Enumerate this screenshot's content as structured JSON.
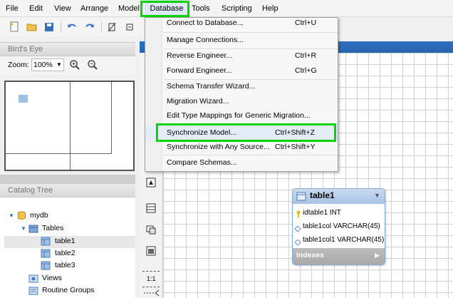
{
  "menubar": {
    "items": [
      "File",
      "Edit",
      "View",
      "Arrange",
      "Model",
      "Database",
      "Tools",
      "Scripting",
      "Help"
    ]
  },
  "birdseye": {
    "title": "Bird's Eye",
    "zoom_label": "Zoom:",
    "zoom_value": "100%"
  },
  "catalog": {
    "title": "Catalog Tree",
    "items": {
      "schema": "mydb",
      "tables_folder": "Tables",
      "tables": [
        "table1",
        "table2",
        "table3"
      ],
      "views_folder": "Views",
      "routine_groups_folder": "Routine Groups"
    }
  },
  "database_menu": {
    "items": [
      {
        "label": "Connect to Database...",
        "shortcut": "Ctrl+U"
      },
      {
        "label": "Manage Connections...",
        "shortcut": ""
      },
      {
        "label": "Reverse Engineer...",
        "shortcut": "Ctrl+R"
      },
      {
        "label": "Forward Engineer...",
        "shortcut": "Ctrl+G"
      },
      {
        "label": "Schema Transfer Wizard...",
        "shortcut": ""
      },
      {
        "label": "Migration Wizard...",
        "shortcut": ""
      },
      {
        "label": "Edit Type Mappings for Generic Migration...",
        "shortcut": ""
      },
      {
        "label": "Synchronize Model...",
        "shortcut": "Ctrl+Shift+Z"
      },
      {
        "label": "Synchronize with Any Source...",
        "shortcut": "Ctrl+Shift+Y"
      },
      {
        "label": "Compare Schemas...",
        "shortcut": ""
      }
    ]
  },
  "er_table": {
    "name": "table1",
    "columns": [
      "idtable1 INT",
      "table1col VARCHAR(45)",
      "table1col1 VARCHAR(45)"
    ],
    "indexes_label": "Indexes"
  },
  "tool_column": {
    "ratio_label": "1:1"
  },
  "colors": {
    "highlight_box": "#00d400",
    "canvas_header": "#2663b0",
    "er_header": "#a8c3e6"
  }
}
